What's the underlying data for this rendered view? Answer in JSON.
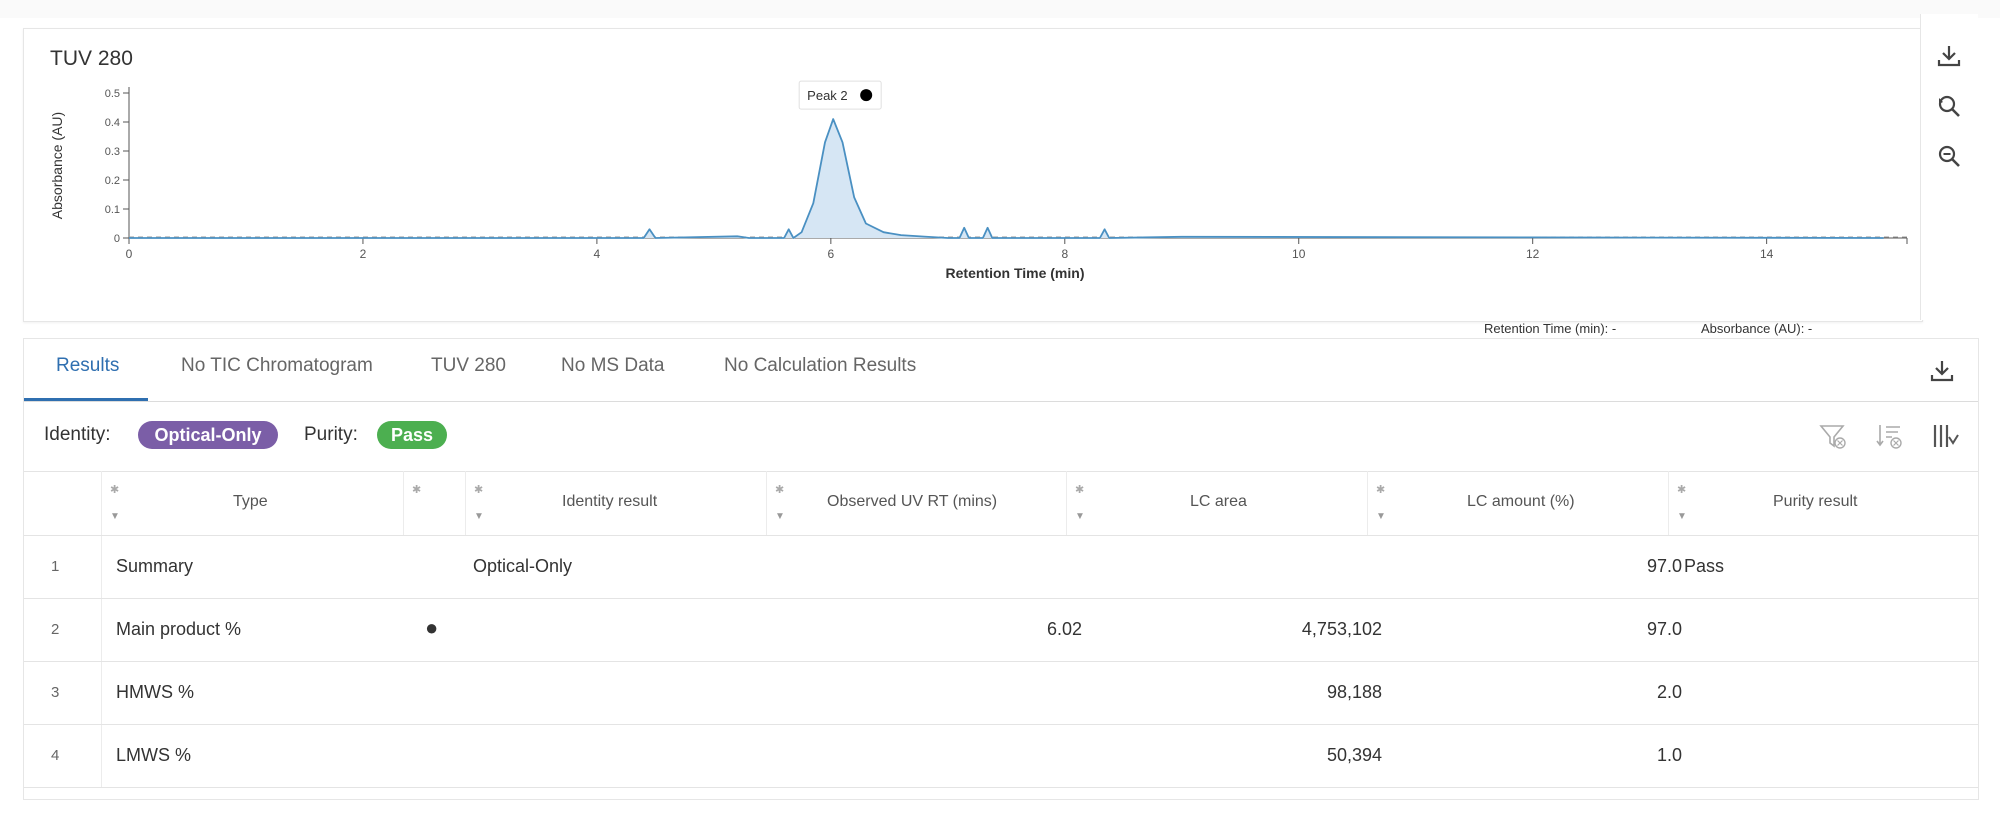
{
  "chart": {
    "title": "TUV 280",
    "readout_rt": "Retention Time (min): -",
    "readout_abs": "Absorbance (AU): -",
    "line_color": "#4a90c2",
    "fill_color": "#d6e6f4"
  },
  "chart_data": {
    "type": "line",
    "title": "TUV 280",
    "xlabel": "Retention Time (min)",
    "ylabel": "Absorbance (AU)",
    "xlim": [
      0,
      15.2
    ],
    "ylim": [
      0,
      0.5
    ],
    "x_ticks": [
      "0",
      "2",
      "4",
      "6",
      "8",
      "10",
      "12",
      "14"
    ],
    "y_ticks": [
      "0",
      "0.1",
      "0.2",
      "0.3",
      "0.4",
      "0.5"
    ],
    "grid": false,
    "series": [
      {
        "x": [
          0,
          4.4,
          4.45,
          4.5,
          5.2,
          5.3,
          5.6,
          5.64,
          5.68,
          5.75,
          5.85,
          5.95,
          6.02,
          6.1,
          6.2,
          6.3,
          6.45,
          6.6,
          6.8,
          7.0,
          7.1,
          7.14,
          7.18,
          7.3,
          7.34,
          7.38,
          8.3,
          8.34,
          8.38,
          9.0,
          12.0,
          15.0
        ],
        "y": [
          0,
          0,
          0.03,
          0,
          0.006,
          0,
          0,
          0.03,
          0,
          0.02,
          0.12,
          0.33,
          0.41,
          0.33,
          0.14,
          0.05,
          0.02,
          0.01,
          0.005,
          0,
          0,
          0.035,
          0,
          0,
          0.035,
          0,
          0,
          0.03,
          0,
          0.004,
          0.002,
          0
        ]
      }
    ],
    "annotations": [
      {
        "label": "Peak 2",
        "x": 6.02,
        "y": 0.41
      }
    ]
  },
  "toolbar": {
    "download_icon": "download-icon",
    "zoom_reset_icon": "zoom-reset-icon",
    "zoom_out_icon": "zoom-out-icon"
  },
  "tabs": [
    {
      "label": "Results"
    },
    {
      "label": "No TIC Chromatogram"
    },
    {
      "label": "TUV 280"
    },
    {
      "label": "No MS Data"
    },
    {
      "label": "No Calculation Results"
    }
  ],
  "status": {
    "identity_label": "Identity:",
    "identity_value": "Optical-Only",
    "identity_color": "#7b5ea7",
    "purity_label": "Purity:",
    "purity_value": "Pass",
    "purity_color": "#4caf50"
  },
  "table": {
    "headers": {
      "type": "Type",
      "identity": "Identity result",
      "rt": "Observed UV RT (mins)",
      "area": "LC area",
      "amount": "LC amount (%)",
      "purity": "Purity result"
    },
    "rows": [
      {
        "num": "1",
        "type": "Summary",
        "marker": "",
        "identity": "Optical-Only",
        "rt": "",
        "area": "",
        "amount": "97.0",
        "purity": "Pass"
      },
      {
        "num": "2",
        "type": "Main product %",
        "marker": "●",
        "identity": "",
        "rt": "6.02",
        "area": "4,753,102",
        "amount": "97.0",
        "purity": ""
      },
      {
        "num": "3",
        "type": "HMWS %",
        "marker": "",
        "identity": "",
        "rt": "",
        "area": "98,188",
        "amount": "2.0",
        "purity": ""
      },
      {
        "num": "4",
        "type": "LMWS %",
        "marker": "",
        "identity": "",
        "rt": "",
        "area": "50,394",
        "amount": "1.0",
        "purity": ""
      }
    ]
  }
}
